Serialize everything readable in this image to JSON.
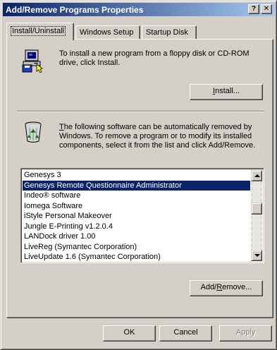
{
  "window": {
    "title": "Add/Remove Programs Properties"
  },
  "titlebar_buttons": {
    "help": "?",
    "close": "✕"
  },
  "tabs": [
    {
      "label": "Install/Uninstall"
    },
    {
      "label": "Windows Setup"
    },
    {
      "label": "Startup Disk"
    }
  ],
  "install_section": {
    "text": "To install a new program from a floppy disk or CD-ROM drive, click Install.",
    "button": {
      "label_mnemonic": "I",
      "label_rest": "nstall..."
    }
  },
  "remove_section": {
    "text_mnemonic": "T",
    "text_rest": "he following software can be automatically removed by Windows. To remove a program or to modify its installed components, select it from the list and click Add/Remove."
  },
  "program_list": {
    "items": [
      {
        "label": "Genesys 3"
      },
      {
        "label": "Genesys Remote Questionnaire Administrator",
        "selected": true
      },
      {
        "label": "Indeo® software"
      },
      {
        "label": "Iomega Software"
      },
      {
        "label": "iStyle Personal Makeover"
      },
      {
        "label": "Jungle E-Printing v1.2.0.4"
      },
      {
        "label": "LANDock driver 1.00"
      },
      {
        "label": "LiveReg (Symantec Corporation)"
      },
      {
        "label": "LiveUpdate 1.6 (Symantec Corporation)"
      }
    ],
    "scroll_position": 0.38
  },
  "add_remove_button": {
    "label_start": "Add/",
    "label_mnemonic": "R",
    "label_rest": "emove..."
  },
  "dialog_buttons": {
    "ok": "OK",
    "cancel": "Cancel",
    "apply": "Apply"
  }
}
